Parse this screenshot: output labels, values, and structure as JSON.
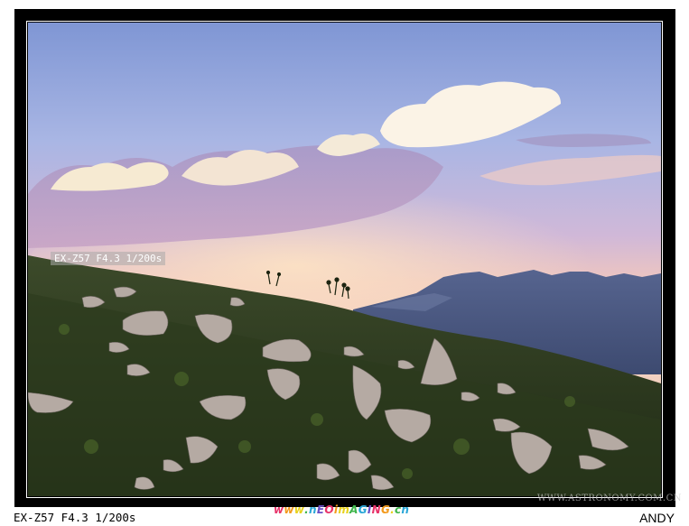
{
  "photo": {
    "exif_overlay": "EX-Z57 F4.3 1/200s",
    "site_watermark": "WWW.ASTRONOMY.COM.CN"
  },
  "caption": {
    "exif": "EX-Z57 F4.3 1/200s",
    "author": "ANDY"
  },
  "logo": {
    "text": "www.nEOimAGING.cn",
    "colors": [
      "#e8336a",
      "#f39a1c",
      "#e7d21c",
      "#3db54a",
      "#2aa7d8",
      "#6a4fc7"
    ]
  },
  "colors": {
    "frame": "#000000",
    "sky_top": "#7e98d6",
    "sky_glow": "#f2c8b4",
    "mountains": "#4a5c8a",
    "grass": "#2e3a1e"
  }
}
